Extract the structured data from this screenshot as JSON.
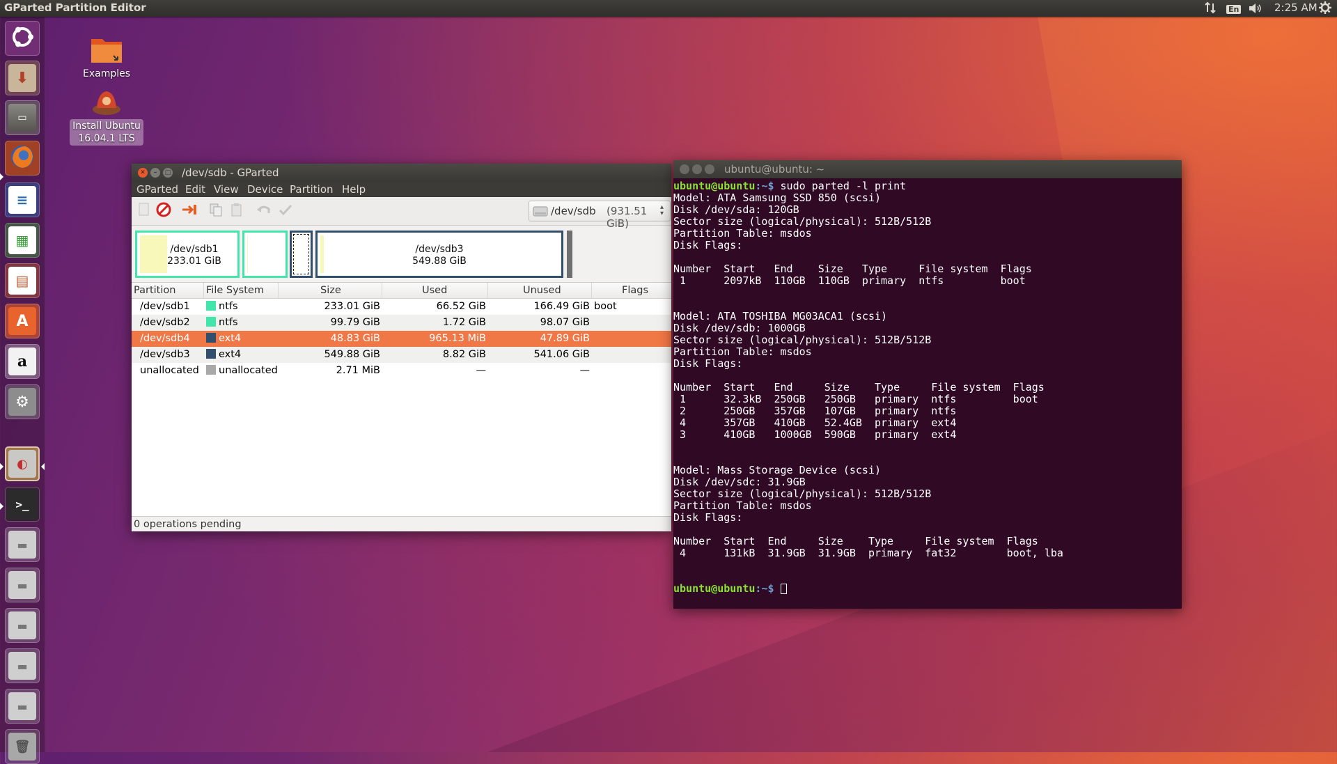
{
  "top_panel": {
    "title": "GParted Partition Editor",
    "keyboard_layout": "En",
    "clock": "2:25 AM",
    "icons": [
      "network-updown-icon",
      "keyboard-layout-icon",
      "volume-icon",
      "power-gear-icon"
    ]
  },
  "launcher": {
    "items": [
      {
        "name": "ubuntu-dash",
        "icon": "ubuntu-logo-icon",
        "color": "#7b3d7d"
      },
      {
        "name": "install-ubuntu",
        "icon": "installer-icon",
        "color": "#8b6a5a"
      },
      {
        "name": "files",
        "icon": "file-cabinet-icon",
        "color": "#6f6d68"
      },
      {
        "name": "firefox",
        "icon": "firefox-icon",
        "color": "#e66000"
      },
      {
        "name": "libreoffice-writer",
        "icon": "writer-doc-icon",
        "color": "#2d6db4"
      },
      {
        "name": "libreoffice-calc",
        "icon": "calc-sheet-icon",
        "color": "#3c9e3a"
      },
      {
        "name": "libreoffice-impress",
        "icon": "impress-slide-icon",
        "color": "#c0592f"
      },
      {
        "name": "ubuntu-software",
        "icon": "software-center-icon",
        "color": "#e9632c"
      },
      {
        "name": "amazon",
        "icon": "amazon-icon",
        "color": "#e8e8e8"
      },
      {
        "name": "system-settings",
        "icon": "settings-wrench-icon",
        "color": "#888"
      },
      {
        "name": "gparted",
        "icon": "gparted-disk-icon",
        "color": "#9b7a3b"
      },
      {
        "name": "terminal",
        "icon": "terminal-icon",
        "color": "#2b2b2b"
      },
      {
        "name": "drive-1",
        "icon": "drive-icon",
        "color": "#bcbcbc"
      },
      {
        "name": "drive-2",
        "icon": "drive-icon",
        "color": "#bcbcbc"
      },
      {
        "name": "drive-3",
        "icon": "drive-icon",
        "color": "#bcbcbc"
      },
      {
        "name": "drive-4",
        "icon": "drive-icon",
        "color": "#bcbcbc"
      },
      {
        "name": "drive-5",
        "icon": "drive-icon",
        "color": "#bcbcbc"
      },
      {
        "name": "trash",
        "icon": "trash-icon",
        "color": "#9a9a9a"
      }
    ]
  },
  "desktop": {
    "icons": [
      {
        "label": "Examples"
      },
      {
        "label_line1": "Install Ubuntu",
        "label_line2": "16.04.1 LTS"
      }
    ]
  },
  "gparted": {
    "title": "/dev/sdb - GParted",
    "menu": [
      "GParted",
      "Edit",
      "View",
      "Device",
      "Partition",
      "Help"
    ],
    "device_selector": {
      "device": "/dev/sdb",
      "size": "(931.51 GiB)"
    },
    "partition_map": [
      {
        "name": "/dev/sdb1",
        "size": "233.01 GiB",
        "fs": "ntfs",
        "used_fraction": 0.286
      },
      {
        "name": "",
        "size": "",
        "fs": "ntfs",
        "used_fraction": 0.02
      },
      {
        "name": "",
        "size": "",
        "fs": "ext4",
        "used_fraction": 0.02
      },
      {
        "name": "/dev/sdb3",
        "size": "549.88 GiB",
        "fs": "ext4",
        "used_fraction": 0.016
      }
    ],
    "columns": [
      "Partition",
      "File System",
      "Size",
      "Used",
      "Unused",
      "Flags"
    ],
    "rows": [
      {
        "partition": "/dev/sdb1",
        "fs": "ntfs",
        "fs_color": "#42e5ac",
        "size": "233.01 GiB",
        "used": "66.52 GiB",
        "unused": "166.49 GiB",
        "flags": "boot"
      },
      {
        "partition": "/dev/sdb2",
        "fs": "ntfs",
        "fs_color": "#42e5ac",
        "size": "99.79 GiB",
        "used": "1.72 GiB",
        "unused": "98.07 GiB",
        "flags": ""
      },
      {
        "partition": "/dev/sdb4",
        "fs": "ext4",
        "fs_color": "#314e6c",
        "size": "48.83 GiB",
        "used": "965.13 MiB",
        "unused": "47.89 GiB",
        "flags": ""
      },
      {
        "partition": "/dev/sdb3",
        "fs": "ext4",
        "fs_color": "#314e6c",
        "size": "549.88 GiB",
        "used": "8.82 GiB",
        "unused": "541.06 GiB",
        "flags": ""
      },
      {
        "partition": "unallocated",
        "fs": "unallocated",
        "fs_color": "#a9a9a9",
        "size": "2.71 MiB",
        "used": "—",
        "unused": "—",
        "flags": ""
      }
    ],
    "selected_row": 2,
    "status": "0 operations pending",
    "colors": {
      "ntfs": "#42e5ac",
      "ext4": "#314e6c",
      "selection": "#f07746",
      "used": "#f8f8ba"
    }
  },
  "terminal": {
    "title": "ubuntu@ubuntu: ~",
    "prompt_user": "ubuntu@ubuntu",
    "prompt_path": ":~$ ",
    "command": "sudo parted -l print",
    "output": [
      "Model: ATA Samsung SSD 850 (scsi)",
      "Disk /dev/sda: 120GB",
      "Sector size (logical/physical): 512B/512B",
      "Partition Table: msdos",
      "Disk Flags:",
      "",
      "Number  Start   End    Size   Type     File system  Flags",
      " 1      2097kB  110GB  110GB  primary  ntfs         boot",
      "",
      "",
      "Model: ATA TOSHIBA MG03ACA1 (scsi)",
      "Disk /dev/sdb: 1000GB",
      "Sector size (logical/physical): 512B/512B",
      "Partition Table: msdos",
      "Disk Flags:",
      "",
      "Number  Start   End     Size    Type     File system  Flags",
      " 1      32.3kB  250GB   250GB   primary  ntfs         boot",
      " 2      250GB   357GB   107GB   primary  ntfs",
      " 4      357GB   410GB   52.4GB  primary  ext4",
      " 3      410GB   1000GB  590GB   primary  ext4",
      "",
      "",
      "Model: Mass Storage Device (scsi)",
      "Disk /dev/sdc: 31.9GB",
      "Sector size (logical/physical): 512B/512B",
      "Partition Table: msdos",
      "Disk Flags:",
      "",
      "Number  Start  End     Size    Type     File system  Flags",
      " 4      131kB  31.9GB  31.9GB  primary  fat32        boot, lba",
      "",
      ""
    ],
    "colors": {
      "background": "#300a24",
      "prompt_user": "#8ae234",
      "prompt_path": "#729fcf"
    }
  }
}
